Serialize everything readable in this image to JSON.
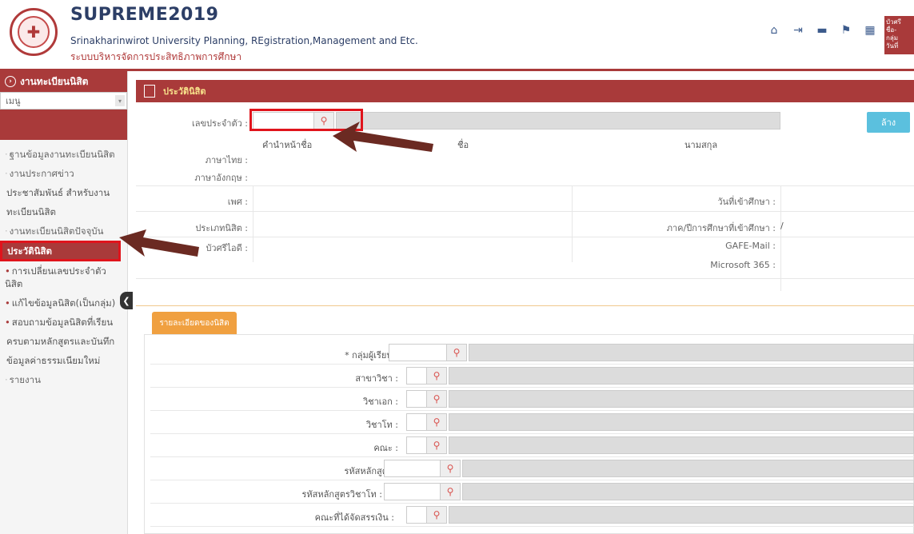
{
  "header": {
    "app_title": "SUPREME2019",
    "subtitle_en": "Srinakharinwirot University Planning, REgistration,Management and Etc.",
    "subtitle_th": "ระบบบริหารจัดการประสิทธิภาพการศึกษา",
    "logo_glyph": "✚",
    "user_lines": [
      "บัวศรี",
      "ชื่อ-",
      "กลุ่ม",
      "วันที่"
    ],
    "icons": [
      "home-icon",
      "sign-out-icon",
      "keyboard-icon",
      "flag-icon",
      "calendar-icon"
    ]
  },
  "sidebar": {
    "section_title": "งานทะเบียนนิสิต",
    "select_value": "เมนู",
    "items": [
      {
        "label": "ฐานข้อมูลงานทะเบียนนิสิต",
        "type": "group"
      },
      {
        "label": "งานประกาศข่าว",
        "type": "group"
      },
      {
        "label": "ประชาสัมพันธ์ สำหรับงาน",
        "type": "text"
      },
      {
        "label": "ทะเบียนนิสิต",
        "type": "text"
      },
      {
        "label": "งานทะเบียนนิสิตปัจจุบัน",
        "type": "group"
      },
      {
        "label": "ประวัตินิสิต",
        "type": "active"
      },
      {
        "label": "การเปลี่ยนเลขประจำตัวนิสิต",
        "type": "bullet"
      },
      {
        "label": "แก้ไขข้อมูลนิสิต(เป็นกลุ่ม)",
        "type": "bullet"
      },
      {
        "label": "สอบถามข้อมูลนิสิตที่เรียน",
        "type": "bullet"
      },
      {
        "label": "ครบตามหลักสูตรและบันทึก",
        "type": "text"
      },
      {
        "label": "ข้อมูลค่าธรรมเนียมใหม่",
        "type": "text"
      },
      {
        "label": "รายงาน",
        "type": "group"
      }
    ]
  },
  "main": {
    "panel_title": "ประวัตินิสิต",
    "id_label": "เลขประจำตัว :",
    "clear_button": "ล้าง",
    "name_headers": {
      "prefix": "คำนำหน้าชื่อ",
      "first": "ชื่อ",
      "last": "นามสกุล"
    },
    "thai_label": "ภาษาไทย :",
    "eng_label": "ภาษาอังกฤษ :",
    "gender_label": "เพศ :",
    "entry_date_label": "วันที่เข้าศึกษา :",
    "student_type_label": "ประเภทนิสิต :",
    "entry_term_label": "ภาค/ปีการศึกษาที่เข้าศึกษา :",
    "entry_term_value": "/",
    "buasri_label": "บัวศรีไอดี :",
    "gafe_label": "GAFE-Mail :",
    "ms365_label": "Microsoft 365 :",
    "section_tab": "รายละเอียดของนิสิต",
    "fields": [
      {
        "label": "* กลุ่มผู้เรียน :"
      },
      {
        "label": "สาขาวิชา :"
      },
      {
        "label": "วิชาเอก :"
      },
      {
        "label": "วิชาโท :"
      },
      {
        "label": "คณะ :"
      },
      {
        "label": "รหัสหลักสูตร :"
      },
      {
        "label": "รหัสหลักสูตรวิชาโท :"
      },
      {
        "label": "คณะที่ได้จัดสรรเงิน :"
      }
    ]
  },
  "colors": {
    "brand": "#a93a3a",
    "highlight": "#e0141c",
    "info_button": "#5bc0de",
    "tab_orange": "#f0a040"
  }
}
